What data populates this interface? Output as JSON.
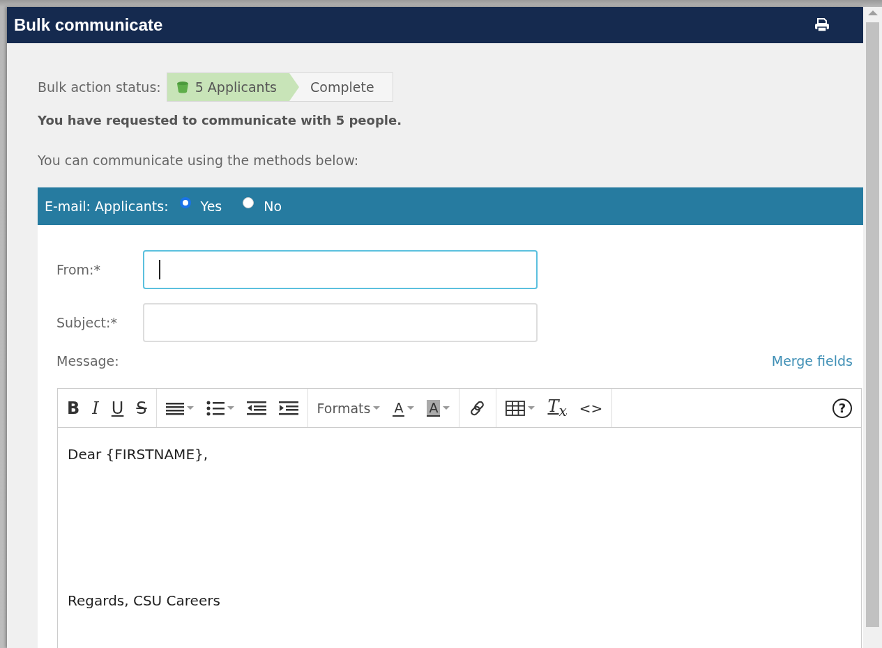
{
  "window": {
    "title": "Bulk communicate"
  },
  "status": {
    "label": "Bulk action status:",
    "steps": [
      {
        "label": "5 Applicants",
        "selected": true
      },
      {
        "label": "Complete",
        "selected": false
      }
    ]
  },
  "summary": "You have requested to communicate with 5 people.",
  "intro": "You can communicate using the methods below:",
  "email": {
    "label": "E-mail: Applicants:",
    "options": [
      {
        "label": "Yes",
        "selected": true
      },
      {
        "label": "No",
        "selected": false
      }
    ],
    "fields": [
      {
        "label": "From:*",
        "focused": true
      },
      {
        "label": "Subject:*",
        "focused": false
      }
    ],
    "message_label": "Message:",
    "merge_link": "Merge fields",
    "toolbar": [
      [
        {
          "kind": "bold",
          "label": "B",
          "caret": false
        },
        {
          "kind": "italic",
          "label": "I",
          "caret": false
        },
        {
          "kind": "underline",
          "label": "U",
          "caret": false
        },
        {
          "kind": "strike",
          "label": "S",
          "caret": false
        }
      ],
      [
        {
          "kind": "align",
          "caret": true
        },
        {
          "kind": "bullets",
          "caret": true
        },
        {
          "kind": "outdent",
          "caret": false
        },
        {
          "kind": "indent",
          "caret": false
        }
      ],
      [
        {
          "kind": "formats",
          "label": "Formats",
          "caret": true
        },
        {
          "kind": "color",
          "label": "A",
          "caret": true
        },
        {
          "kind": "bgcolor",
          "label": "A",
          "caret": true
        }
      ],
      [
        {
          "kind": "link",
          "caret": false
        }
      ],
      [
        {
          "kind": "table",
          "caret": true
        },
        {
          "kind": "clear",
          "label": "T$_{x}$",
          "caret": false
        },
        {
          "kind": "code",
          "label": "<>",
          "caret": false
        }
      ],
      [
        {
          "kind": "help",
          "label": "?",
          "caret": false
        }
      ]
    ],
    "body": [
      "Dear {FIRSTNAME},",
      "Regards, CSU Careers"
    ]
  }
}
